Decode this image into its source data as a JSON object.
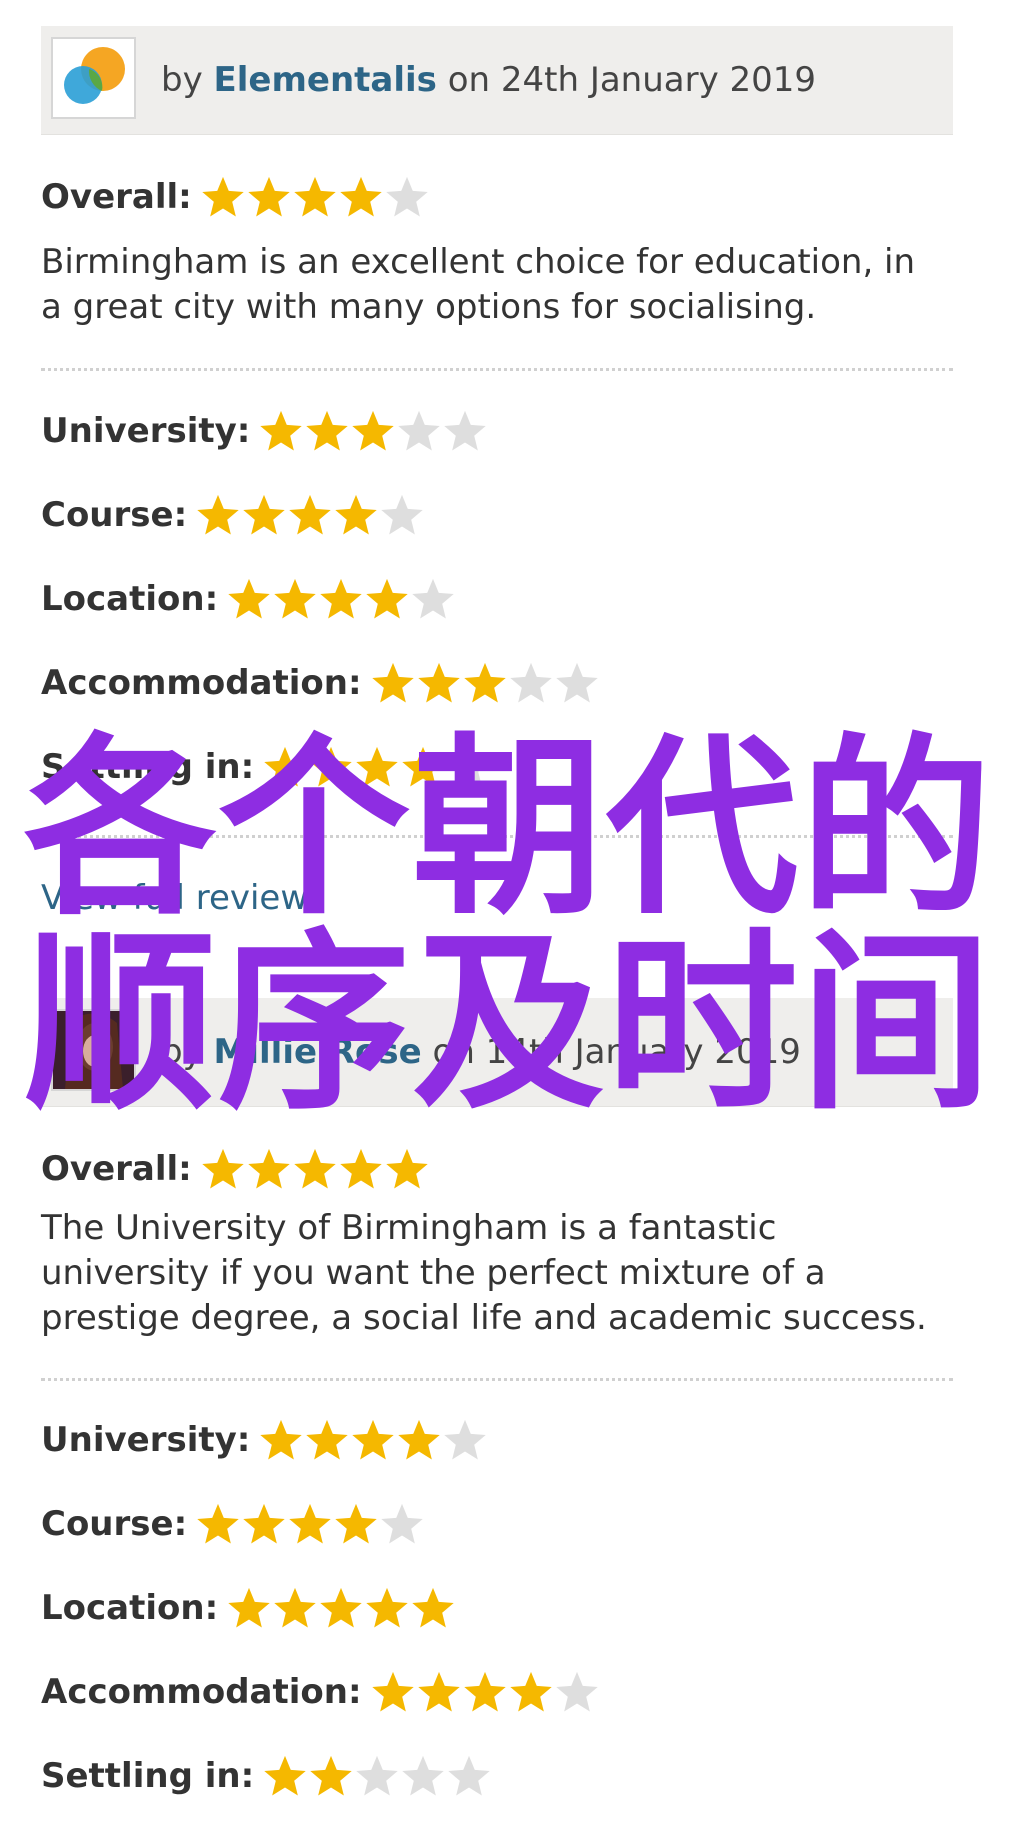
{
  "reviews": [
    {
      "by": "by",
      "reviewer": "Elementalis",
      "date_text": "on 24th January 2019",
      "overall_label": "Overall:",
      "overall_rating": 4,
      "summary": "Birmingham is an excellent choice for education, in a great city with many options for socialising.",
      "ratings": [
        {
          "label": "University:",
          "value": 3
        },
        {
          "label": "Course:",
          "value": 4
        },
        {
          "label": "Location:",
          "value": 4
        },
        {
          "label": "Accommodation:",
          "value": 3
        },
        {
          "label": "Settling in:",
          "value": 4
        }
      ],
      "full_review_link": "View full review"
    },
    {
      "by": "by",
      "reviewer": "Millie Rose",
      "date_text": "on 14th January 2019",
      "overall_label": "Overall:",
      "overall_rating": 5,
      "summary": "The University of Birmingham is a fantastic university if you want the perfect mixture of a prestige degree, a social life and academic success.",
      "ratings": [
        {
          "label": "University:",
          "value": 4
        },
        {
          "label": "Course:",
          "value": 4
        },
        {
          "label": "Location:",
          "value": 5
        },
        {
          "label": "Accommodation:",
          "value": 4
        },
        {
          "label": "Settling in:",
          "value": 2
        }
      ]
    }
  ],
  "rating_max": 5,
  "watermark": {
    "line1": "各个朝代的",
    "line2": "顺序及时间"
  },
  "colors": {
    "star_filled": "#f5b800",
    "star_empty": "#dedede",
    "link": "#2d6587",
    "header_bg": "#efeeec",
    "watermark": "#8e2de2"
  }
}
